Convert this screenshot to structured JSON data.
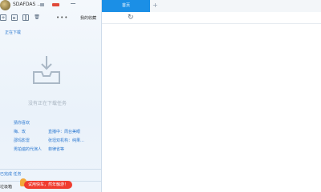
{
  "user": {
    "name": "SDAFDAS ..."
  },
  "toolbar": {
    "more": "•••",
    "cloud": "我的收藏"
  },
  "download": {
    "section_title": "正在下载",
    "empty_text": "没有正在下载任务"
  },
  "recommend": {
    "title": "猜你喜欢",
    "items": [
      "梅、玫",
      "直播中：周台美眼",
      "邵玛影雷",
      "张坦双机构：纯果…",
      "男拍遍的代演人",
      "菲律省等"
    ]
  },
  "footer": {
    "done_label": "已完成 任务",
    "trash_label": "垃圾箱",
    "promo_text": "试用快车，然年触游！"
  },
  "tabs": {
    "active_label": "首页",
    "add_label": "+"
  },
  "nav": {
    "refresh_label": "↻"
  }
}
